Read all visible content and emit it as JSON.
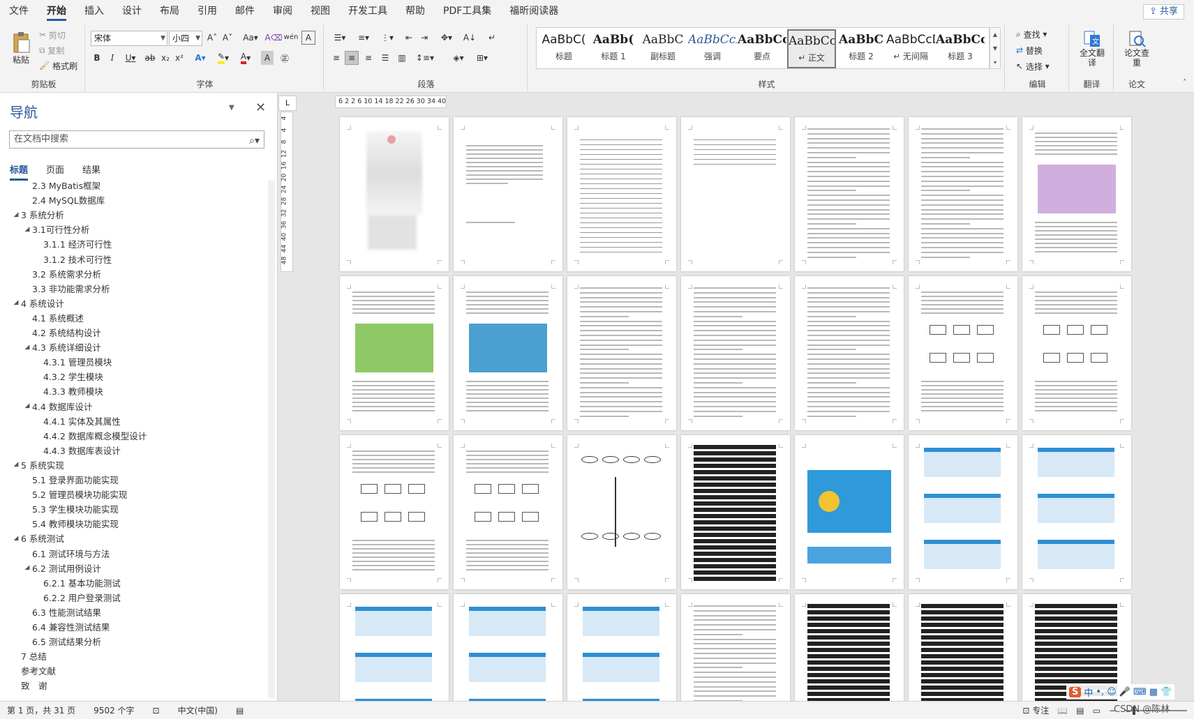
{
  "menu": {
    "tabs": [
      "文件",
      "开始",
      "插入",
      "设计",
      "布局",
      "引用",
      "邮件",
      "审阅",
      "视图",
      "开发工具",
      "帮助",
      "PDF工具集",
      "福昕阅读器"
    ],
    "active": "开始",
    "share": "共享"
  },
  "ribbon": {
    "clipboard": {
      "label": "剪贴板",
      "paste": "粘贴",
      "cut": "剪切",
      "copy": "复制",
      "format_painter": "格式刷"
    },
    "font": {
      "label": "字体",
      "font_name": "宋体",
      "font_size": "小四"
    },
    "paragraph": {
      "label": "段落"
    },
    "styles": {
      "label": "样式",
      "items": [
        {
          "sample": "AaBbC(",
          "name": "标题"
        },
        {
          "sample": "AaBb(",
          "name": "标题 1"
        },
        {
          "sample": "AaBbC",
          "name": "副标题"
        },
        {
          "sample": "AaBbCcL",
          "name": "强调"
        },
        {
          "sample": "AaBbCcl",
          "name": "要点"
        },
        {
          "sample": "AaBbCcI",
          "name": "↵ 正文"
        },
        {
          "sample": "AaBbC",
          "name": "标题 2"
        },
        {
          "sample": "AaBbCcD",
          "name": "↵ 无间隔"
        },
        {
          "sample": "AaBbCcl",
          "name": "标题 3"
        }
      ],
      "selected_index": 5
    },
    "editing": {
      "label": "编辑",
      "find": "查找",
      "replace": "替换",
      "select": "选择"
    },
    "translate": {
      "label": "翻译",
      "button": "全文翻译"
    },
    "paper": {
      "label": "论文",
      "button": "论文查重"
    }
  },
  "nav": {
    "title": "导航",
    "search_placeholder": "在文档中搜索",
    "tabs": [
      "标题",
      "页面",
      "结果"
    ],
    "active_tab": "标题",
    "items": [
      {
        "level": 2,
        "text": "2.3 MyBatis框架",
        "collapsible": false
      },
      {
        "level": 2,
        "text": "2.4 MySQL数据库",
        "collapsible": false
      },
      {
        "level": 1,
        "text": "3 系统分析",
        "collapsible": true
      },
      {
        "level": 2,
        "text": "3.1可行性分析",
        "collapsible": true
      },
      {
        "level": 3,
        "text": "3.1.1 经济可行性",
        "collapsible": false
      },
      {
        "level": 3,
        "text": "3.1.2 技术可行性",
        "collapsible": false
      },
      {
        "level": 2,
        "text": "3.2 系统需求分析",
        "collapsible": false
      },
      {
        "level": 2,
        "text": "3.3 非功能需求分析",
        "collapsible": false
      },
      {
        "level": 1,
        "text": "4 系统设计",
        "collapsible": true
      },
      {
        "level": 2,
        "text": "4.1 系统概述",
        "collapsible": false
      },
      {
        "level": 2,
        "text": "4.2 系统结构设计",
        "collapsible": false
      },
      {
        "level": 2,
        "text": "4.3 系统详细设计",
        "collapsible": true
      },
      {
        "level": 3,
        "text": "4.3.1 管理员模块",
        "collapsible": false
      },
      {
        "level": 3,
        "text": "4.3.2 学生模块",
        "collapsible": false
      },
      {
        "level": 3,
        "text": "4.3.3 教师模块",
        "collapsible": false
      },
      {
        "level": 2,
        "text": "4.4 数据库设计",
        "collapsible": true
      },
      {
        "level": 3,
        "text": "4.4.1 实体及其属性",
        "collapsible": false
      },
      {
        "level": 3,
        "text": "4.4.2 数据库概念模型设计",
        "collapsible": false
      },
      {
        "level": 3,
        "text": "4.4.3 数据库表设计",
        "collapsible": false
      },
      {
        "level": 1,
        "text": "5 系统实现",
        "collapsible": true
      },
      {
        "level": 2,
        "text": "5.1 登录界面功能实现",
        "collapsible": false
      },
      {
        "level": 2,
        "text": "5.2 管理员模块功能实现",
        "collapsible": false
      },
      {
        "level": 2,
        "text": "5.3 学生模块功能实现",
        "collapsible": false
      },
      {
        "level": 2,
        "text": "5.4 教师模块功能实现",
        "collapsible": false
      },
      {
        "level": 1,
        "text": "6 系统测试",
        "collapsible": true
      },
      {
        "level": 2,
        "text": "6.1 测试环境与方法",
        "collapsible": false
      },
      {
        "level": 2,
        "text": "6.2 测试用例设计",
        "collapsible": true
      },
      {
        "level": 3,
        "text": "6.2.1 基本功能测试",
        "collapsible": false
      },
      {
        "level": 3,
        "text": "6.2.2 用户登录测试",
        "collapsible": false
      },
      {
        "level": 2,
        "text": "6.3 性能测试结果",
        "collapsible": false
      },
      {
        "level": 2,
        "text": "6.4 兼容性测试结果",
        "collapsible": false
      },
      {
        "level": 2,
        "text": "6.5 测试结果分析",
        "collapsible": false
      },
      {
        "level": 1,
        "text": "7 总结",
        "collapsible": false
      },
      {
        "level": 1,
        "text": "参考文献",
        "collapsible": false
      },
      {
        "level": 1,
        "text": "致　谢",
        "collapsible": false
      }
    ]
  },
  "ruler": {
    "corner": "L",
    "h_ticks": "6 2 2 6 10 14 18 22 26 30 34 40",
    "v_ticks": [
      "4",
      "4",
      "8",
      "12",
      "16",
      "20",
      "24",
      "28",
      "32",
      "36",
      "40",
      "44",
      "48"
    ]
  },
  "status": {
    "page": "第 1 页，共 31 页",
    "words": "9502 个字",
    "language": "中文(中国)",
    "focus": "专注"
  },
  "ime": {
    "logo": "S",
    "mode": "中"
  },
  "watermark": "CSDN @陈林",
  "colors": {
    "accent": "#2b579a",
    "menubar": "#f3f3f3",
    "doc_bg": "#e6e6e6"
  }
}
